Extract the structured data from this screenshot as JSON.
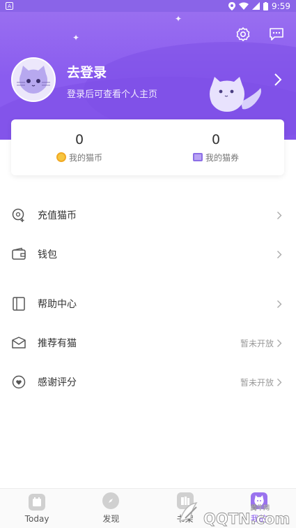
{
  "status_bar": {
    "time": "9:59"
  },
  "header": {
    "title": "去登录",
    "subtitle": "登录后可查看个人主页",
    "icons": [
      "settings-icon",
      "message-icon",
      "chevron-right-icon"
    ]
  },
  "stats": [
    {
      "value": "0",
      "label": "我的猫币",
      "icon": "coin-icon"
    },
    {
      "value": "0",
      "label": "我的猫券",
      "icon": "ticket-icon"
    }
  ],
  "menu": [
    {
      "label": "充值猫币",
      "icon": "recharge-icon",
      "right": ""
    },
    {
      "label": "钱包",
      "icon": "wallet-icon",
      "right": ""
    },
    {
      "label": "帮助中心",
      "icon": "help-book-icon",
      "right": ""
    },
    {
      "label": "推荐有猫",
      "icon": "recommend-icon",
      "right": "暂未开放"
    },
    {
      "label": "感谢评分",
      "icon": "heart-rating-icon",
      "right": "暂未开放"
    }
  ],
  "tabs": [
    {
      "label": "Today",
      "icon": "calendar-icon",
      "active": false
    },
    {
      "label": "发现",
      "icon": "discover-icon",
      "active": false
    },
    {
      "label": "书架",
      "icon": "bookshelf-icon",
      "active": false
    },
    {
      "label": "我的",
      "icon": "profile-cat-icon",
      "active": true
    }
  ],
  "watermark": {
    "text": "QQTN.com",
    "small": "腾牛网"
  },
  "colors": {
    "accent": "#8a5cef",
    "header_top": "#9c72f0"
  }
}
